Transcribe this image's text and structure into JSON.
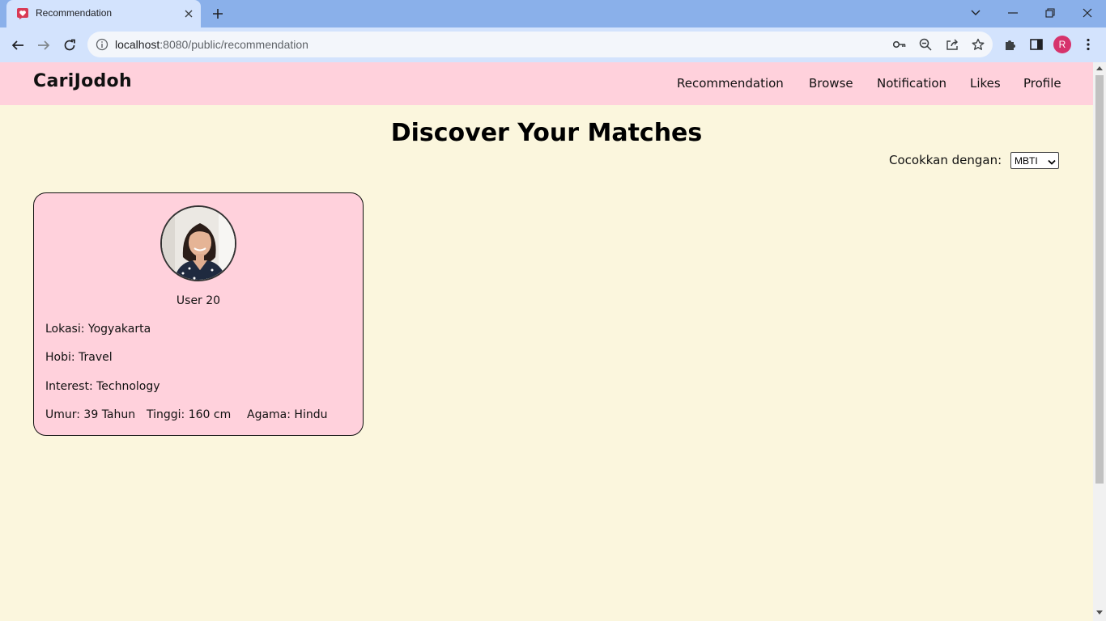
{
  "browser": {
    "tab_title": "Recommendation",
    "url_host": "localhost",
    "url_rest": ":8080/public/recommendation",
    "profile_initial": "R"
  },
  "site": {
    "logo": "CariJodoh",
    "nav": [
      "Recommendation",
      "Browse",
      "Notification",
      "Likes",
      "Profile"
    ]
  },
  "main": {
    "title": "Discover Your Matches",
    "match_label": "Cocokkan dengan:",
    "match_value": "MBTI"
  },
  "card": {
    "name": "User 20",
    "location": "Lokasi: Yogyakarta",
    "hobby": "Hobi: Travel",
    "interest": "Interest: Technology",
    "age": "Umur: 39 Tahun",
    "height": "Tinggi: 160 cm",
    "religion": "Agama: Hindu"
  },
  "colors": {
    "header_bg": "#ffd1dc",
    "page_bg": "#fbf6dd",
    "card_bg": "#ffd1dc",
    "chrome_tabbar": "#8ab0ea",
    "chrome_toolbar": "#d3e3fd"
  }
}
